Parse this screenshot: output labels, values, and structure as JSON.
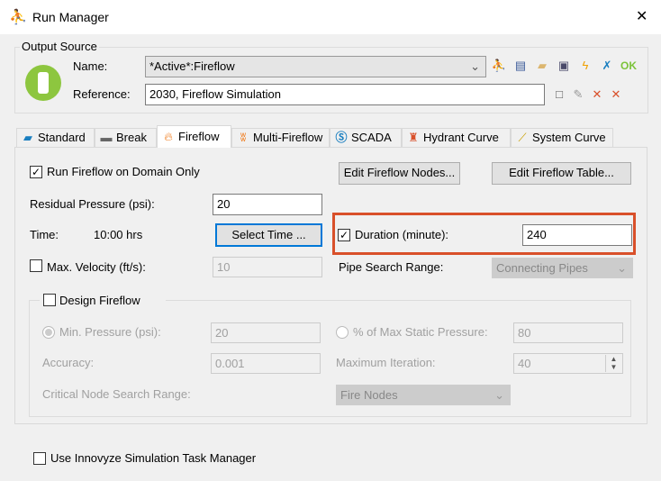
{
  "window": {
    "title": "Run Manager",
    "close": "✕"
  },
  "output_source": {
    "legend": "Output Source",
    "name_label": "Name:",
    "name_value": "*Active*:Fireflow",
    "reference_label": "Reference:",
    "reference_value": "2030, Fireflow Simulation",
    "ok_label": "OK"
  },
  "tabs": [
    {
      "label": "Standard",
      "icon": "folder-icon"
    },
    {
      "label": "Break",
      "icon": "pipe-break-icon"
    },
    {
      "label": "Fireflow",
      "icon": "flame-icon",
      "active": true
    },
    {
      "label": "Multi-Fireflow",
      "icon": "double-flame-icon"
    },
    {
      "label": "SCADA",
      "icon": "scada-icon"
    },
    {
      "label": "Hydrant Curve",
      "icon": "hydrant-icon"
    },
    {
      "label": "System Curve",
      "icon": "curve-icon"
    }
  ],
  "fireflow": {
    "run_domain_label": "Run Fireflow on Domain Only",
    "run_domain_checked": true,
    "edit_nodes": "Edit Fireflow Nodes...",
    "edit_table": "Edit Fireflow Table...",
    "residual_label": "Residual Pressure (psi):",
    "residual_value": "20",
    "time_label": "Time:",
    "time_value": "10:00 hrs",
    "select_time": "Select Time ...",
    "duration_label": "Duration (minute):",
    "duration_checked": true,
    "duration_value": "240",
    "max_velocity_label": "Max. Velocity (ft/s):",
    "max_velocity_checked": false,
    "max_velocity_value": "10",
    "pipe_search_label": "Pipe Search Range:",
    "pipe_search_value": "Connecting Pipes",
    "design": {
      "label": "Design Fireflow",
      "checked": false,
      "min_pressure_label": "Min. Pressure (psi):",
      "min_pressure_value": "20",
      "pct_label": "% of Max Static Pressure:",
      "pct_value": "80",
      "accuracy_label": "Accuracy:",
      "accuracy_value": "0.001",
      "max_iter_label": "Maximum Iteration:",
      "max_iter_value": "40",
      "critical_label": "Critical Node Search Range:",
      "critical_value": "Fire Nodes"
    }
  },
  "task_manager": {
    "label": "Use Innovyze Simulation Task Manager",
    "checked": false
  },
  "colors": {
    "highlight": "#d9502a",
    "accent": "#0078d7",
    "traffic": "#8dc63f"
  }
}
